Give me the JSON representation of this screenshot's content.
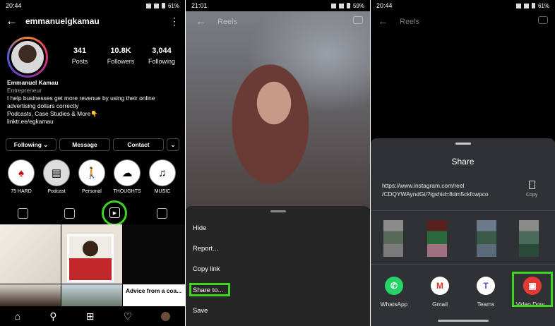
{
  "left_panel": {
    "status_time": "20:44",
    "status_battery": "61%",
    "username": "emmanuelgkamau",
    "stats": [
      {
        "value": "341",
        "label": "Posts"
      },
      {
        "value": "10.8K",
        "label": "Followers"
      },
      {
        "value": "3,044",
        "label": "Following"
      }
    ],
    "bio": {
      "name": "Emmanuel Kamau",
      "category": "Entrepreneur",
      "line1": "I help businesses get more revenue by using their online",
      "line2": "advertising dollars correctly",
      "line3": "Podcasts, Case Studies & More👇",
      "link": "linktr.ee/egkamau"
    },
    "buttons": {
      "following": "Following ⌄",
      "message": "Message",
      "contact": "Contact",
      "more": "⌄"
    },
    "highlights": [
      "75 HARD",
      "Podcast",
      "Personal",
      "THOUGHTS",
      "MUSIC"
    ],
    "grid_caption": "Advice from a coa...",
    "highlight_color": "#3fd41f"
  },
  "middle_panel": {
    "status_time": "21:01",
    "status_battery": "59%",
    "title": "Reels",
    "menu": [
      "Hide",
      "Report...",
      "Copy link",
      "Share to...",
      "Save"
    ]
  },
  "right_panel": {
    "status_time": "20:44",
    "status_battery": "61%",
    "title": "Reels",
    "share_title": "Share",
    "url_line1": "https://www.instagram.com/reel",
    "url_line2": "/CDQYWAyndGi/?igshid=8dm5ckfcwpco",
    "copy_label": "Copy",
    "apps": [
      {
        "label": "WhatsApp",
        "icon": "whatsapp-icon",
        "color": "#25d366"
      },
      {
        "label": "Gmail",
        "icon": "gmail-icon",
        "color": "#ffffff"
      },
      {
        "label": "Teams",
        "icon": "teams-icon",
        "color": "#ffffff"
      },
      {
        "label": "Video Dow...",
        "icon": "video-downloader-icon",
        "color": "#e53935"
      }
    ]
  }
}
